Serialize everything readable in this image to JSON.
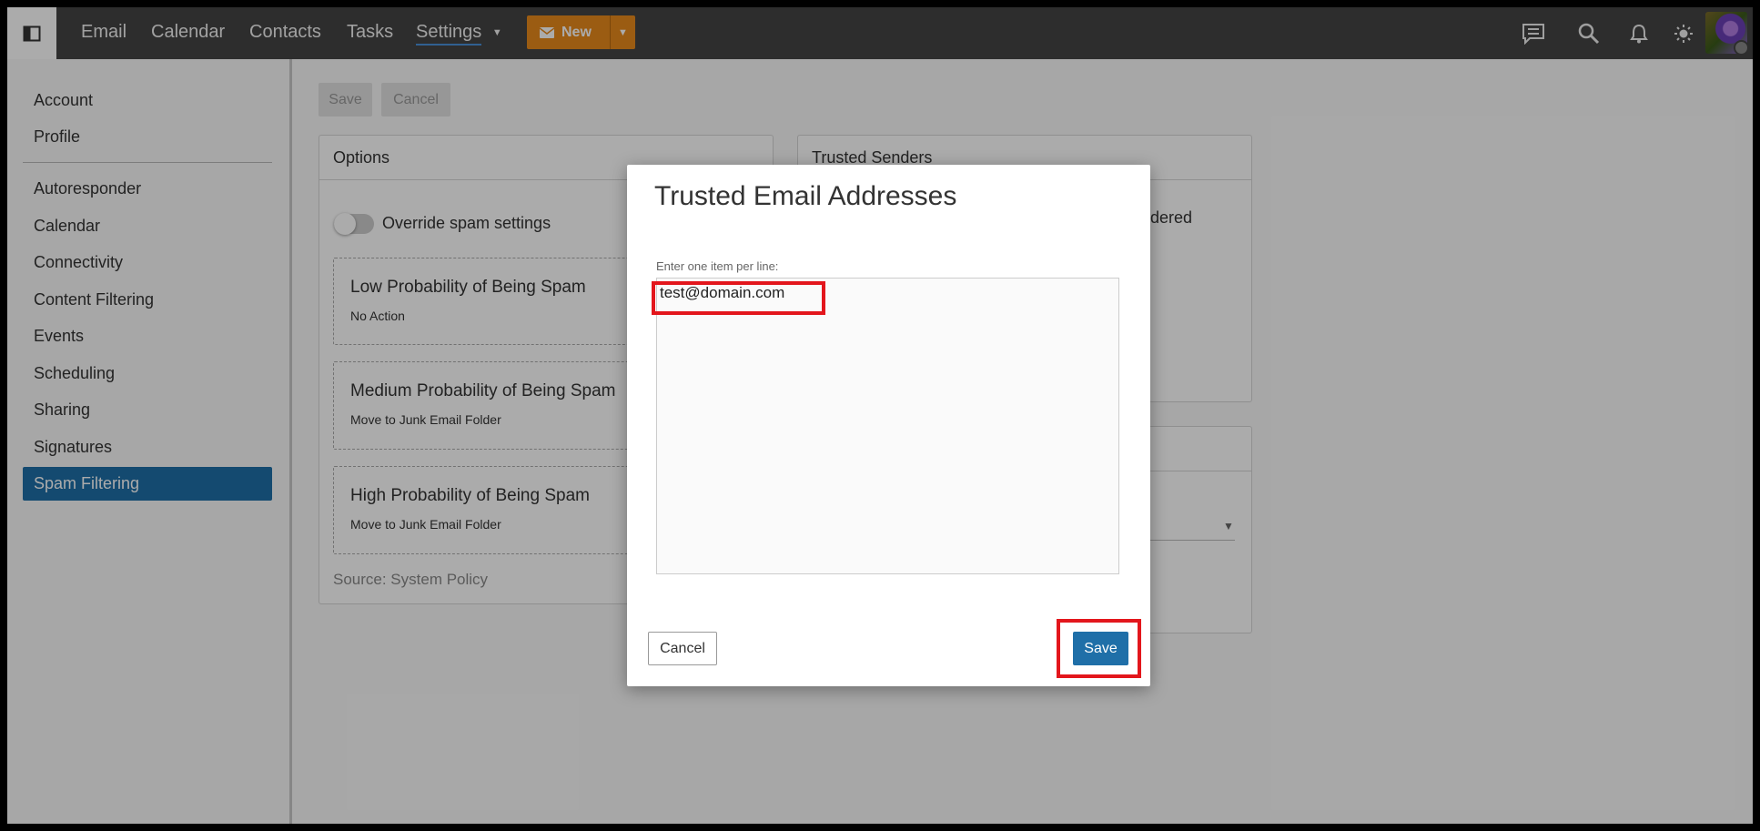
{
  "topbar": {
    "nav": [
      "Email",
      "Calendar",
      "Contacts",
      "Tasks",
      "Settings"
    ],
    "new_label": "New",
    "icons": [
      "chat-icon",
      "search-icon",
      "bell-icon",
      "sun-icon"
    ]
  },
  "sidebar": {
    "items": [
      {
        "label": "Account",
        "active": false
      },
      {
        "label": "Profile",
        "active": false
      },
      {
        "label": "Autoresponder",
        "active": false
      },
      {
        "label": "Calendar",
        "active": false
      },
      {
        "label": "Connectivity",
        "active": false
      },
      {
        "label": "Content Filtering",
        "active": false
      },
      {
        "label": "Events",
        "active": false
      },
      {
        "label": "Scheduling",
        "active": false
      },
      {
        "label": "Sharing",
        "active": false
      },
      {
        "label": "Signatures",
        "active": false
      },
      {
        "label": "Spam Filtering",
        "active": true
      }
    ]
  },
  "toolbar": {
    "save_label": "Save",
    "cancel_label": "Cancel"
  },
  "options_panel": {
    "title": "Options",
    "toggle_label": "Override spam settings",
    "levels": [
      {
        "title": "Low Probability of Being Spam",
        "action": "No Action"
      },
      {
        "title": "Medium Probability of Being Spam",
        "action": "Move to Junk Email Folder"
      },
      {
        "title": "High Probability of Being Spam",
        "action": "Move to Junk Email Folder"
      }
    ],
    "source": "Source: System Policy"
  },
  "trusted_panel": {
    "title": "Trusted Senders",
    "partial_text": "idered"
  },
  "dialog": {
    "title": "Trusted Email Addresses",
    "label": "Enter one item per line:",
    "value": "test@domain.com",
    "cancel_label": "Cancel",
    "save_label": "Save"
  },
  "colors": {
    "accent": "#1f6fa8",
    "new_button": "#e8891c",
    "highlight": "#e3161c",
    "topbar": "#444444"
  }
}
